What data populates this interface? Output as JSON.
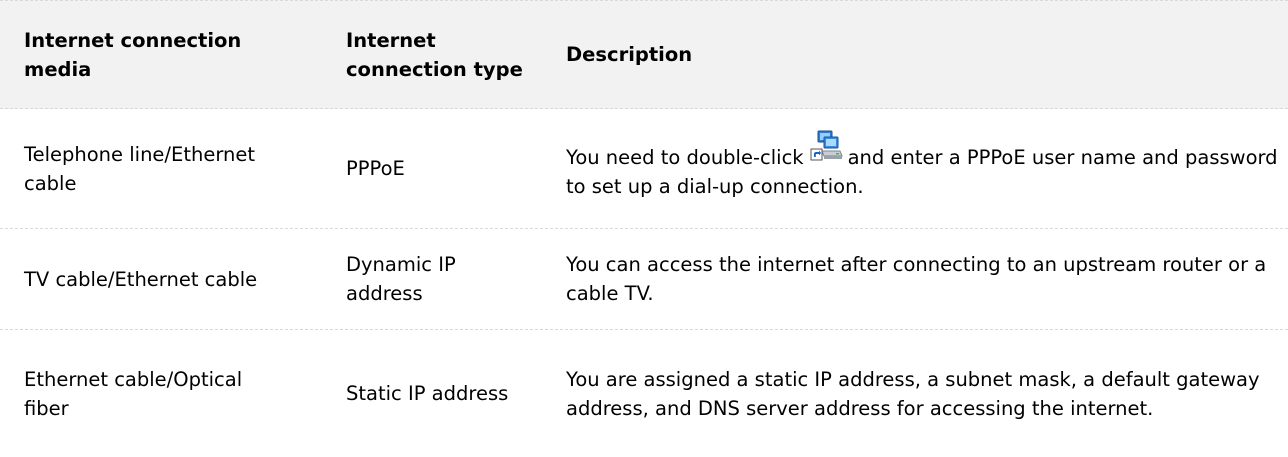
{
  "header": {
    "media": "Internet connection media",
    "type": "Internet connection type",
    "description": "Description"
  },
  "rows": [
    {
      "media": "Telephone line/Ethernet cable",
      "type": "PPPoE",
      "description_before": "You need to double-click",
      "icon": "network-connection-shortcut-icon",
      "description_after": "and enter a PPPoE user name and password to set up a dial-up connection."
    },
    {
      "media": "TV cable/Ethernet cable",
      "type": "Dynamic IP address",
      "description": "You can access the internet after connecting to an upstream router or a cable TV."
    },
    {
      "media": "Ethernet cable/Optical fiber",
      "type": "Static IP address",
      "description": "You are assigned a static IP address, a subnet mask, a default gateway address, and DNS server address for accessing the internet."
    }
  ]
}
